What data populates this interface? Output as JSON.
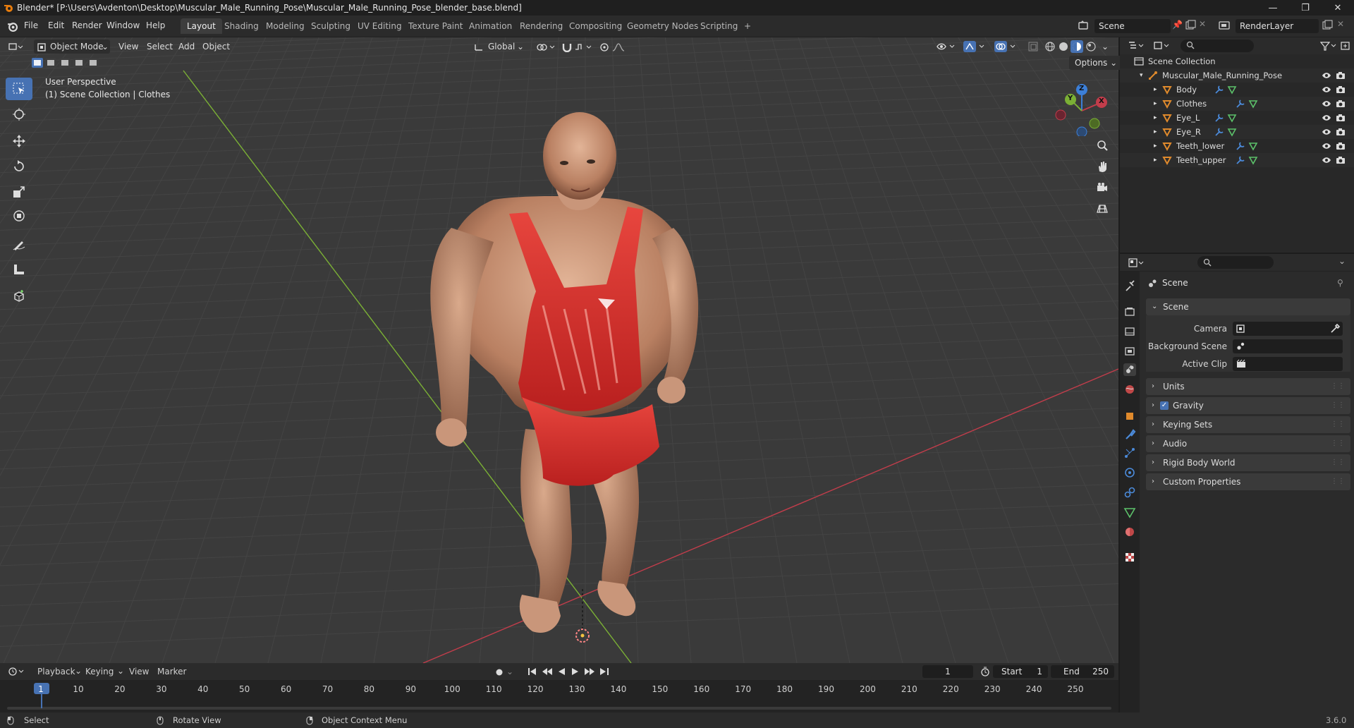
{
  "window": {
    "title": "Blender* [P:\\Users\\Avdenton\\Desktop\\Muscular_Male_Running_Pose\\Muscular_Male_Running_Pose_blender_base.blend]",
    "minimize": "—",
    "maximize": "❐",
    "close": "✕"
  },
  "menubar": {
    "items": [
      "File",
      "Edit",
      "Render",
      "Window",
      "Help"
    ],
    "workspaces": [
      "Layout",
      "Shading",
      "Modeling",
      "Sculpting",
      "UV Editing",
      "Texture Paint",
      "Animation",
      "Rendering",
      "Compositing",
      "Geometry Nodes",
      "Scripting"
    ],
    "add_workspace": "+",
    "scene": "Scene",
    "view_layer": "RenderLayer"
  },
  "viewport": {
    "mode": "Object Mode",
    "menus": [
      "View",
      "Select",
      "Add",
      "Object"
    ],
    "orientation": "Global",
    "options": "Options",
    "perspective": "User Perspective",
    "collection": "(1) Scene Collection | Clothes",
    "gizmo": {
      "x": "X",
      "y": "Y",
      "z": "Z"
    }
  },
  "outliner": {
    "root": "Scene Collection",
    "collection": "Muscular_Male_Running_Pose",
    "objects": [
      "Body",
      "Clothes",
      "Eye_L",
      "Eye_R",
      "Teeth_lower",
      "Teeth_upper"
    ]
  },
  "properties": {
    "context": "Scene",
    "panel_title": "Scene",
    "camera_label": "Camera",
    "background_label": "Background Scene",
    "clip_label": "Active Clip",
    "panels": [
      "Units",
      "Gravity",
      "Keying Sets",
      "Audio",
      "Rigid Body World",
      "Custom Properties"
    ],
    "gravity_checked": true
  },
  "timeline": {
    "menus": [
      "Playback",
      "Keying",
      "View",
      "Marker"
    ],
    "current_frame": "1",
    "start_label": "Start",
    "start": "1",
    "end_label": "End",
    "end": "250",
    "ticks": [
      "1",
      "10",
      "20",
      "30",
      "40",
      "50",
      "60",
      "70",
      "80",
      "90",
      "100",
      "110",
      "120",
      "130",
      "140",
      "150",
      "160",
      "170",
      "180",
      "190",
      "200",
      "210",
      "220",
      "230",
      "240",
      "250"
    ]
  },
  "statusbar": {
    "select": "Select",
    "rotate": "Rotate View",
    "context_menu": "Object Context Menu",
    "version": "3.6.0"
  },
  "colors": {
    "accent": "#4772b3",
    "x_axis": "#c23d4b",
    "y_axis": "#7bb035",
    "z_axis": "#3c7fd8",
    "object_orange": "#e08a2c"
  }
}
